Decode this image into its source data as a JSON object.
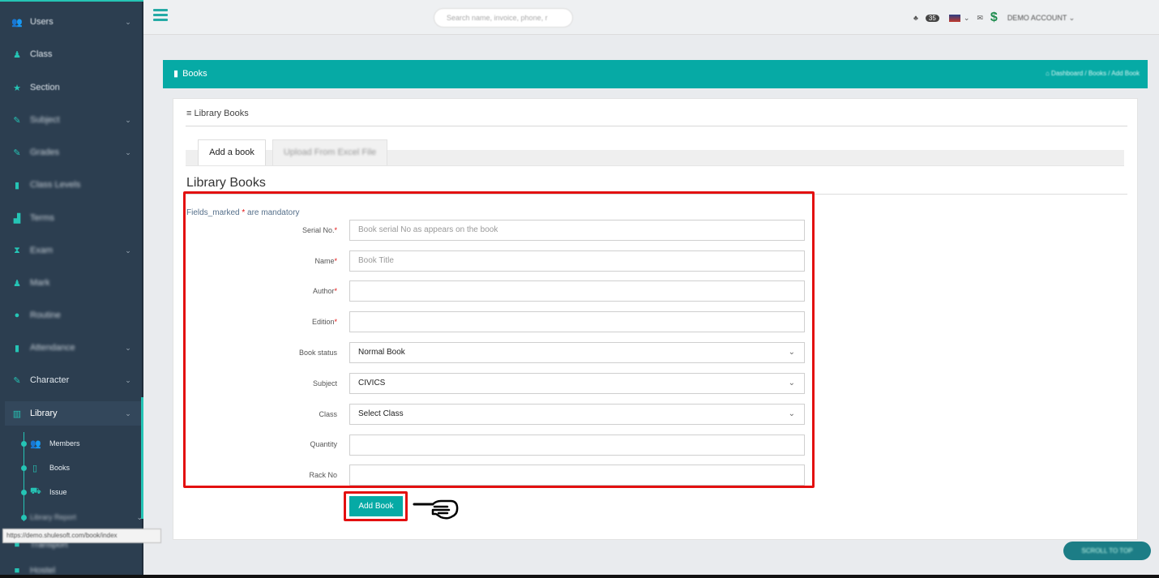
{
  "sidebar": {
    "items": [
      {
        "label": "Users",
        "icon": "users-icon",
        "chev": true
      },
      {
        "label": "Class",
        "icon": "class-icon",
        "chev": false
      },
      {
        "label": "Section",
        "icon": "star-icon",
        "chev": false
      },
      {
        "label": "Subject",
        "icon": "edit-icon",
        "chev": true
      },
      {
        "label": "Grades",
        "icon": "edit-icon",
        "chev": true
      },
      {
        "label": "Class Levels",
        "icon": "level-icon",
        "chev": false
      },
      {
        "label": "Terms",
        "icon": "chart-icon",
        "chev": false
      },
      {
        "label": "Exam",
        "icon": "hourglass-icon",
        "chev": true
      },
      {
        "label": "Mark",
        "icon": "user-icon",
        "chev": false
      },
      {
        "label": "Routine",
        "icon": "circle-icon",
        "chev": false
      },
      {
        "label": "Attendance",
        "icon": "clipboard-icon",
        "chev": true
      },
      {
        "label": "Character",
        "icon": "edit-icon",
        "chev": true
      },
      {
        "label": "Library",
        "icon": "library-icon",
        "chev": true
      }
    ],
    "library_sub": [
      {
        "label": "Members"
      },
      {
        "label": "Books"
      },
      {
        "label": "Issue"
      },
      {
        "label": "Library Report"
      }
    ],
    "extra_items": [
      "Transport",
      "Hostel"
    ],
    "url_tooltip": "https://demo.shulesoft.com/book/index"
  },
  "topbar": {
    "search_placeholder": "Search name, invoice, phone, r",
    "badge": "35",
    "account_label": "DEMO ACCOUNT ⌄"
  },
  "header": {
    "title": "Books",
    "breadcrumb": "⌂ Dashboard / Books / Add Book"
  },
  "card": {
    "title": "Library Books",
    "tabs": [
      "Add a book",
      "Upload From Excel File"
    ],
    "section_title": "Library Books",
    "mandatory_prefix": "Fields_marked ",
    "mandatory_star": "*",
    "mandatory_suffix": " are mandatory"
  },
  "form": {
    "fields": [
      {
        "label": "Serial No.",
        "required": "*",
        "placeholder": "Book serial No as appears on the book",
        "value": ""
      },
      {
        "label": "Name",
        "required": "*",
        "placeholder": "Book Title",
        "value": ""
      },
      {
        "label": "Author",
        "required": "*",
        "placeholder": "",
        "value": ""
      },
      {
        "label": "Edition",
        "required": "*",
        "placeholder": "",
        "value": ""
      },
      {
        "label": "Book status",
        "required": "",
        "selected": "Normal Book"
      },
      {
        "label": "Subject",
        "required": "",
        "selected": "CIVICS"
      },
      {
        "label": "Class",
        "required": "",
        "selected": "Select Class"
      },
      {
        "label": "Quantity",
        "required": "",
        "placeholder": "",
        "value": ""
      },
      {
        "label": "Rack No",
        "required": "",
        "placeholder": "",
        "value": ""
      }
    ],
    "submit_label": "Add Book"
  },
  "scroll_top_label": "SCROLL TO TOP",
  "colors": {
    "accent": "#06aaa5",
    "sidebar": "#2c3e50",
    "highlight": "#e31010"
  }
}
